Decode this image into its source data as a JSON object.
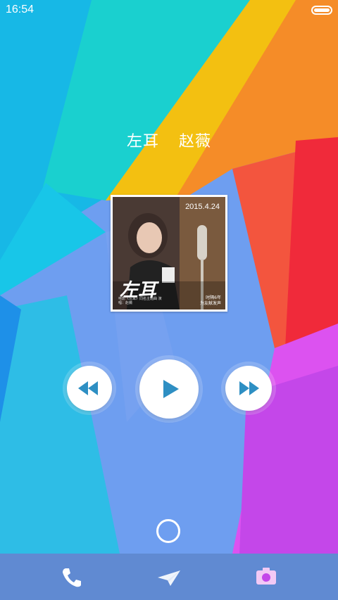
{
  "status_bar": {
    "time": "16:54",
    "battery_level": 1.0
  },
  "now_playing": {
    "title": "左耳",
    "artist": "赵薇",
    "cover": {
      "date": "2015.4.24",
      "title": "左耳",
      "caption_left": "电影《左耳》同名主题曲 演唱：赵薇",
      "caption_right_line1": "时隔6年",
      "caption_right_line2": "为友献发声"
    }
  },
  "controls": {
    "previous_icon": "rewind-icon",
    "play_icon": "play-icon",
    "next_icon": "fast-forward-icon"
  },
  "dock": {
    "items": [
      "phone-icon",
      "send-icon",
      "camera-icon"
    ]
  },
  "colors": {
    "accent": "#2e8fc3",
    "background": "#6c9bea"
  }
}
